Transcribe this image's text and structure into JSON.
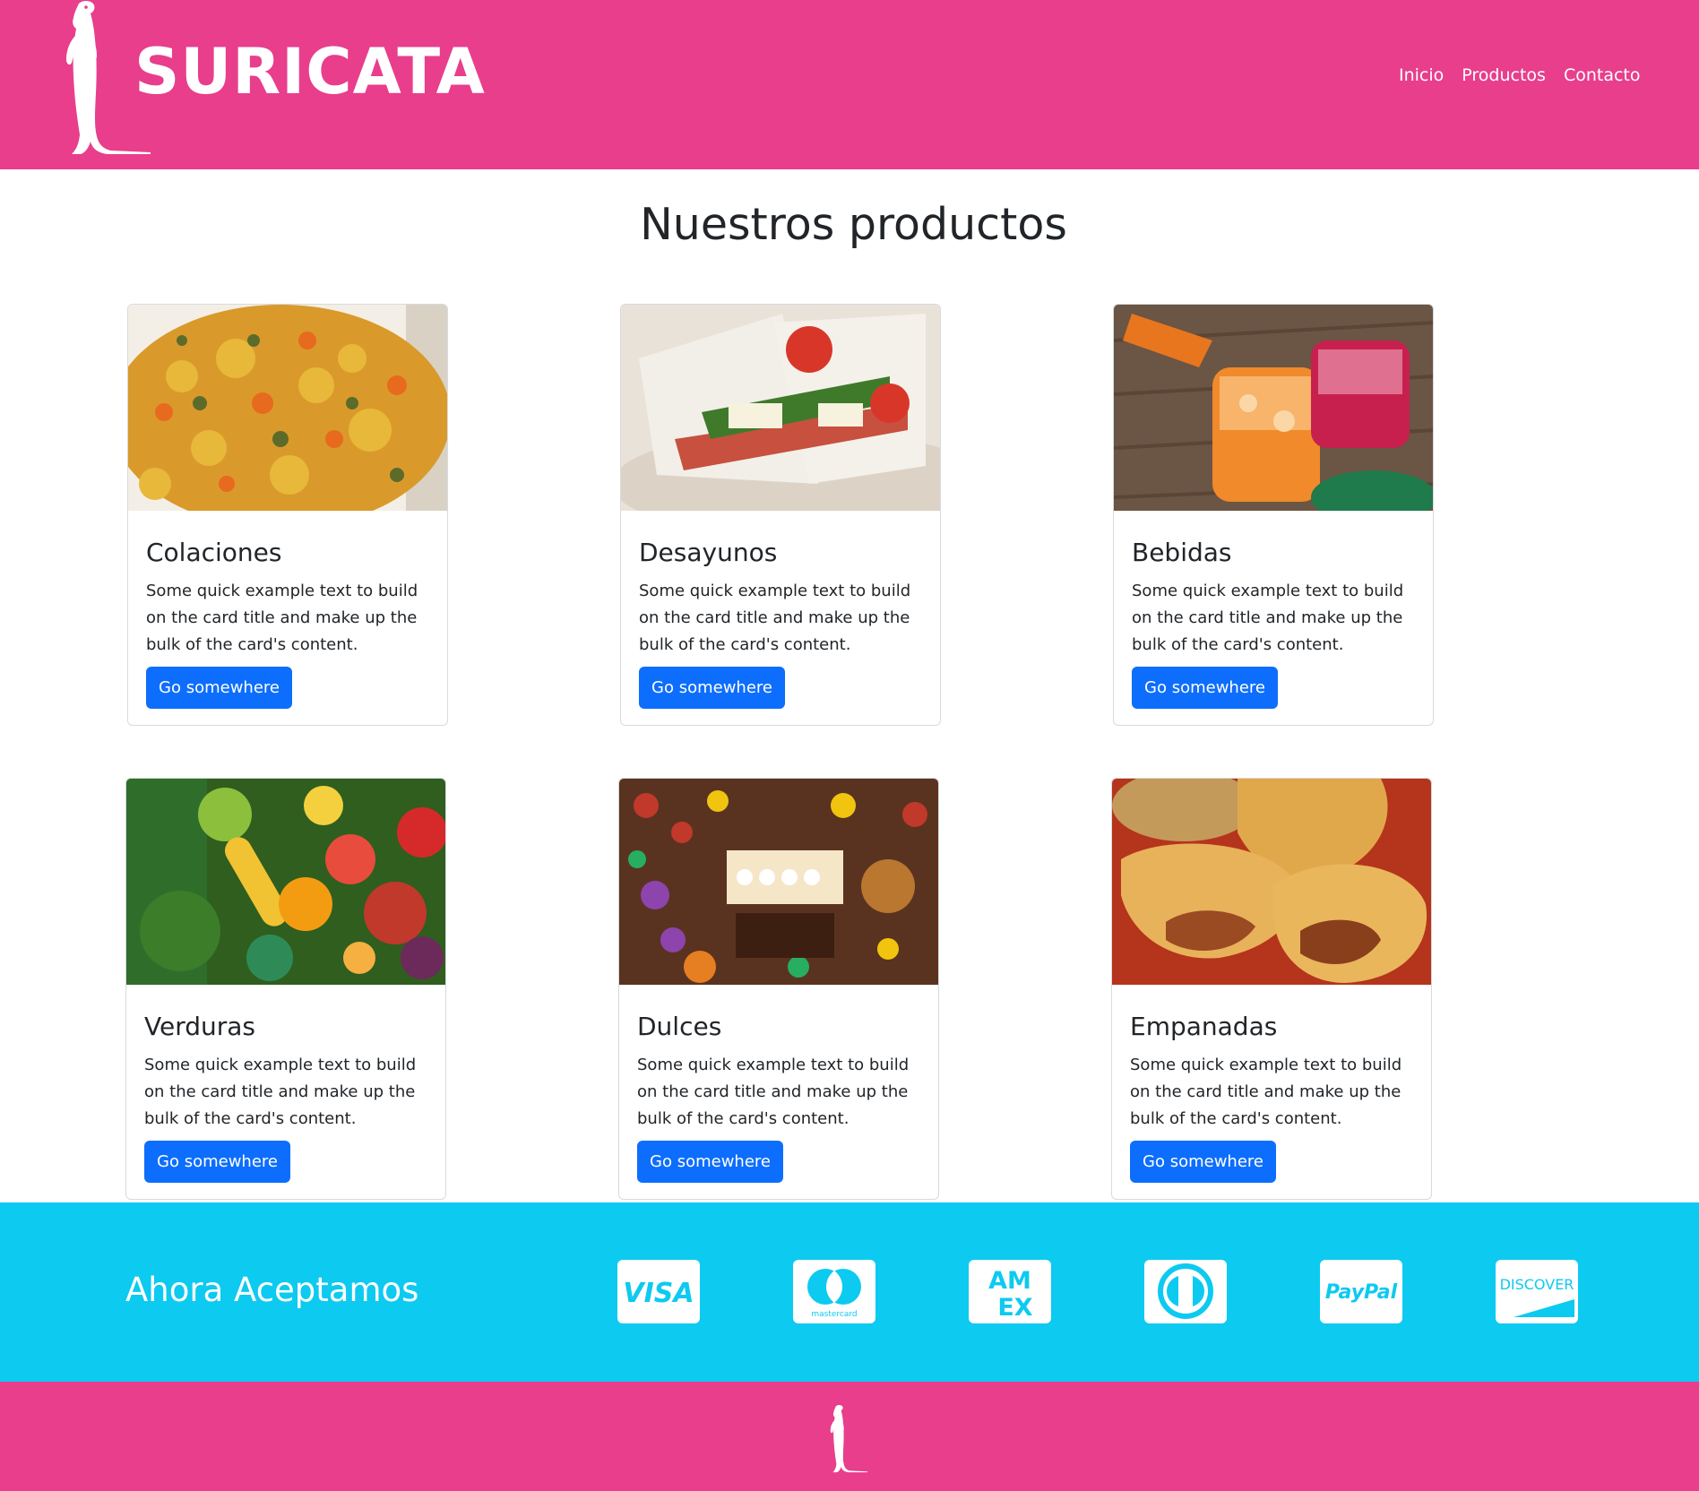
{
  "brand": {
    "name": "SURICATA",
    "logo_icon": "meerkat-icon"
  },
  "nav": {
    "links": [
      "Inicio",
      "Productos",
      "Contacto"
    ]
  },
  "products_section": {
    "title": "Nuestros productos",
    "cards": [
      {
        "title": "Colaciones",
        "image": "colaciones-image",
        "text": "Some quick example text to build on the card title and make up the bulk of the card's content.",
        "button": "Go somewhere"
      },
      {
        "title": "Desayunos",
        "image": "desayunos-image",
        "text": "Some quick example text to build on the card title and make up the bulk of the card's content.",
        "button": "Go somewhere"
      },
      {
        "title": "Bebidas",
        "image": "bebidas-image",
        "text": "Some quick example text to build on the card title and make up the bulk of the card's content.",
        "button": "Go somewhere"
      },
      {
        "title": "Verduras",
        "image": "verduras-image",
        "text": "Some quick example text to build on the card title and make up the bulk of the card's content.",
        "button": "Go somewhere"
      },
      {
        "title": "Dulces",
        "image": "dulces-image",
        "text": "Some quick example text to build on the card title and make up the bulk of the card's content.",
        "button": "Go somewhere"
      },
      {
        "title": "Empanadas",
        "image": "empanadas-image",
        "text": "Some quick example text to build on the card title and make up the bulk of the card's content.",
        "button": "Go somewhere"
      }
    ]
  },
  "payment": {
    "title": "Ahora Aceptamos",
    "methods": [
      {
        "label": "VISA",
        "icon": "visa-icon"
      },
      {
        "label": "mastercard",
        "icon": "mastercard-icon"
      },
      {
        "label": "AMEX",
        "icon": "amex-icon"
      },
      {
        "label": "",
        "icon": "diners-club-icon"
      },
      {
        "label": "PayPal",
        "icon": "paypal-icon"
      },
      {
        "label": "DISCOVER",
        "icon": "discover-icon"
      }
    ]
  },
  "footer": {
    "logo_icon": "meerkat-icon"
  },
  "colors": {
    "header_bg": "#e83e8c",
    "footer_bg": "#e83e8c",
    "payment_bg": "#0dcaf0",
    "button_bg": "#0d6efd",
    "text": "#212529"
  }
}
